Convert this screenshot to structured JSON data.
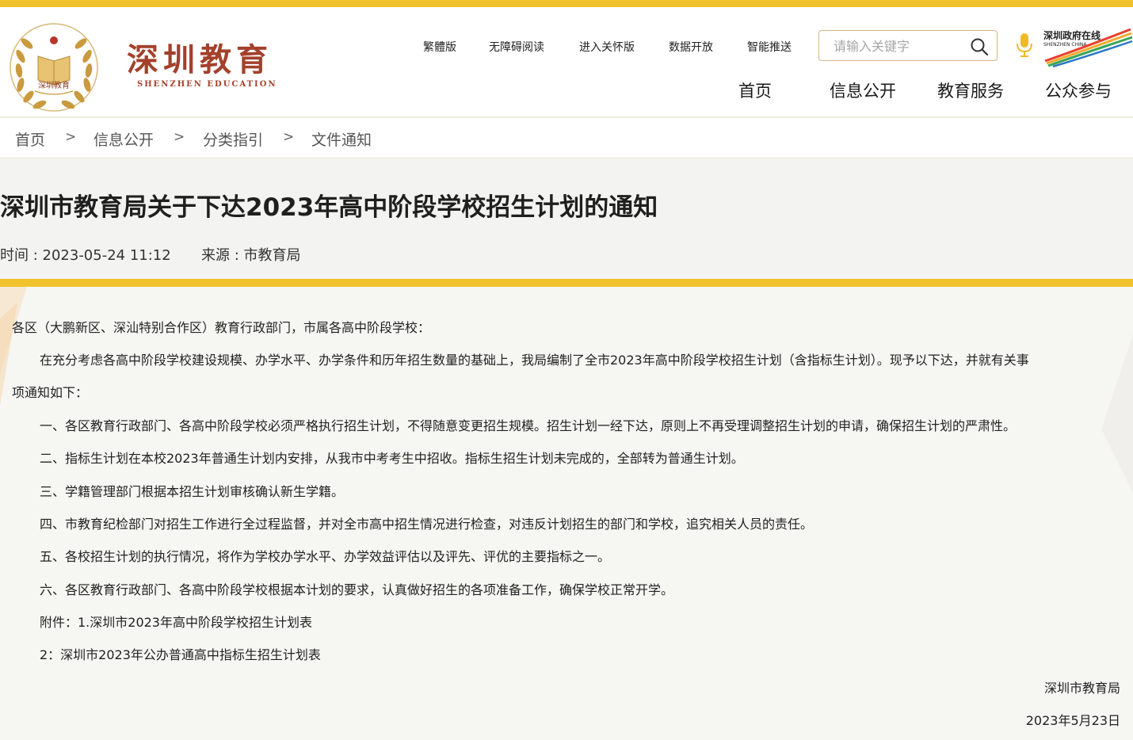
{
  "header": {
    "logo_cn": "深圳教育",
    "logo_en": "SHENZHEN EDUCATION",
    "badge_text": "深圳教育",
    "util_links": [
      "繁體版",
      "无障碍阅读",
      "进入关怀版",
      "数据开放",
      "智能推送"
    ],
    "search_placeholder": "请输入关键字",
    "city_logo_cn": "深圳政府在线",
    "city_logo_en": "SHENZHEN CHINA",
    "nav": [
      "首页",
      "信息公开",
      "教育服务",
      "公众参与"
    ]
  },
  "breadcrumb": [
    "首页",
    "信息公开",
    "分类指引",
    "文件通知"
  ],
  "breadcrumb_sep": ">",
  "article": {
    "title": "深圳市教育局关于下达2023年高中阶段学校招生计划的通知",
    "time_label": "时间 : 2023-05-24 11:12",
    "source_label": "来源 : 市教育局",
    "greeting": "各区（大鹏新区、深汕特别合作区）教育行政部门，市属各高中阶段学校：",
    "intro_line1": "在充分考虑各高中阶段学校建设规模、办学水平、办学条件和历年招生数量的基础上，我局编制了全市2023年高中阶段学校招生计划（含指标生计划）。现予以下达，并就有关事",
    "intro_line2": "项通知如下：",
    "items": [
      "一、各区教育行政部门、各高中阶段学校必须严格执行招生计划，不得随意变更招生规模。招生计划一经下达，原则上不再受理调整招生计划的申请，确保招生计划的严肃性。",
      "二、指标生计划在本校2023年普通生计划内安排，从我市中考考生中招收。指标生招生计划未完成的，全部转为普通生计划。",
      "三、学籍管理部门根据本招生计划审核确认新生学籍。",
      "四、市教育纪检部门对招生工作进行全过程监督，并对全市高中招生情况进行检查，对违反计划招生的部门和学校，追究相关人员的责任。",
      "五、各校招生计划的执行情况，将作为学校办学水平、办学效益评估以及评先、评优的主要指标之一。",
      "六、各区教育行政部门、各高中阶段学校根据本计划的要求，认真做好招生的各项准备工作，确保学校正常开学。"
    ],
    "attachment_1": "附件：1.深圳市2023年高中阶段学校招生计划表",
    "attachment_2": "2：深圳市2023年公办普通高中指标生招生计划表",
    "signature": "深圳市教育局",
    "date": "2023年5月23日"
  },
  "colors": {
    "accent_yellow": "#f0c22e",
    "brand_red": "#a3412c",
    "logo_gold": "#c99a3e"
  }
}
